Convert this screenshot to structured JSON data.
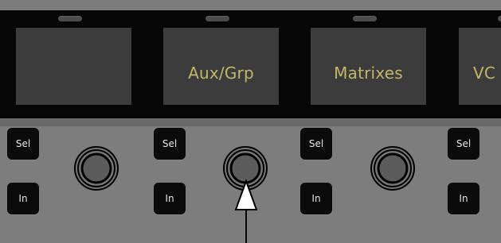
{
  "strips": [
    {
      "display_text": "",
      "select_label": "Sel",
      "input_label": "In"
    },
    {
      "display_text": "Aux/Grp",
      "select_label": "Sel",
      "input_label": "In"
    },
    {
      "display_text": "Matrixes",
      "select_label": "Sel",
      "input_label": "In"
    },
    {
      "display_text": "VC",
      "select_label": "Sel",
      "input_label": "In"
    }
  ],
  "colors": {
    "panel": "#7d7d7d",
    "display_band": "#060606",
    "screen": "#3c3c3c",
    "screen_text": "#c2b66a",
    "button": "#0b0b0b",
    "button_text": "#e8e8e8",
    "callout_arrow": "#000000"
  },
  "callout": {
    "icon": "arrow-up-icon",
    "target": "aux-grp-knob"
  }
}
